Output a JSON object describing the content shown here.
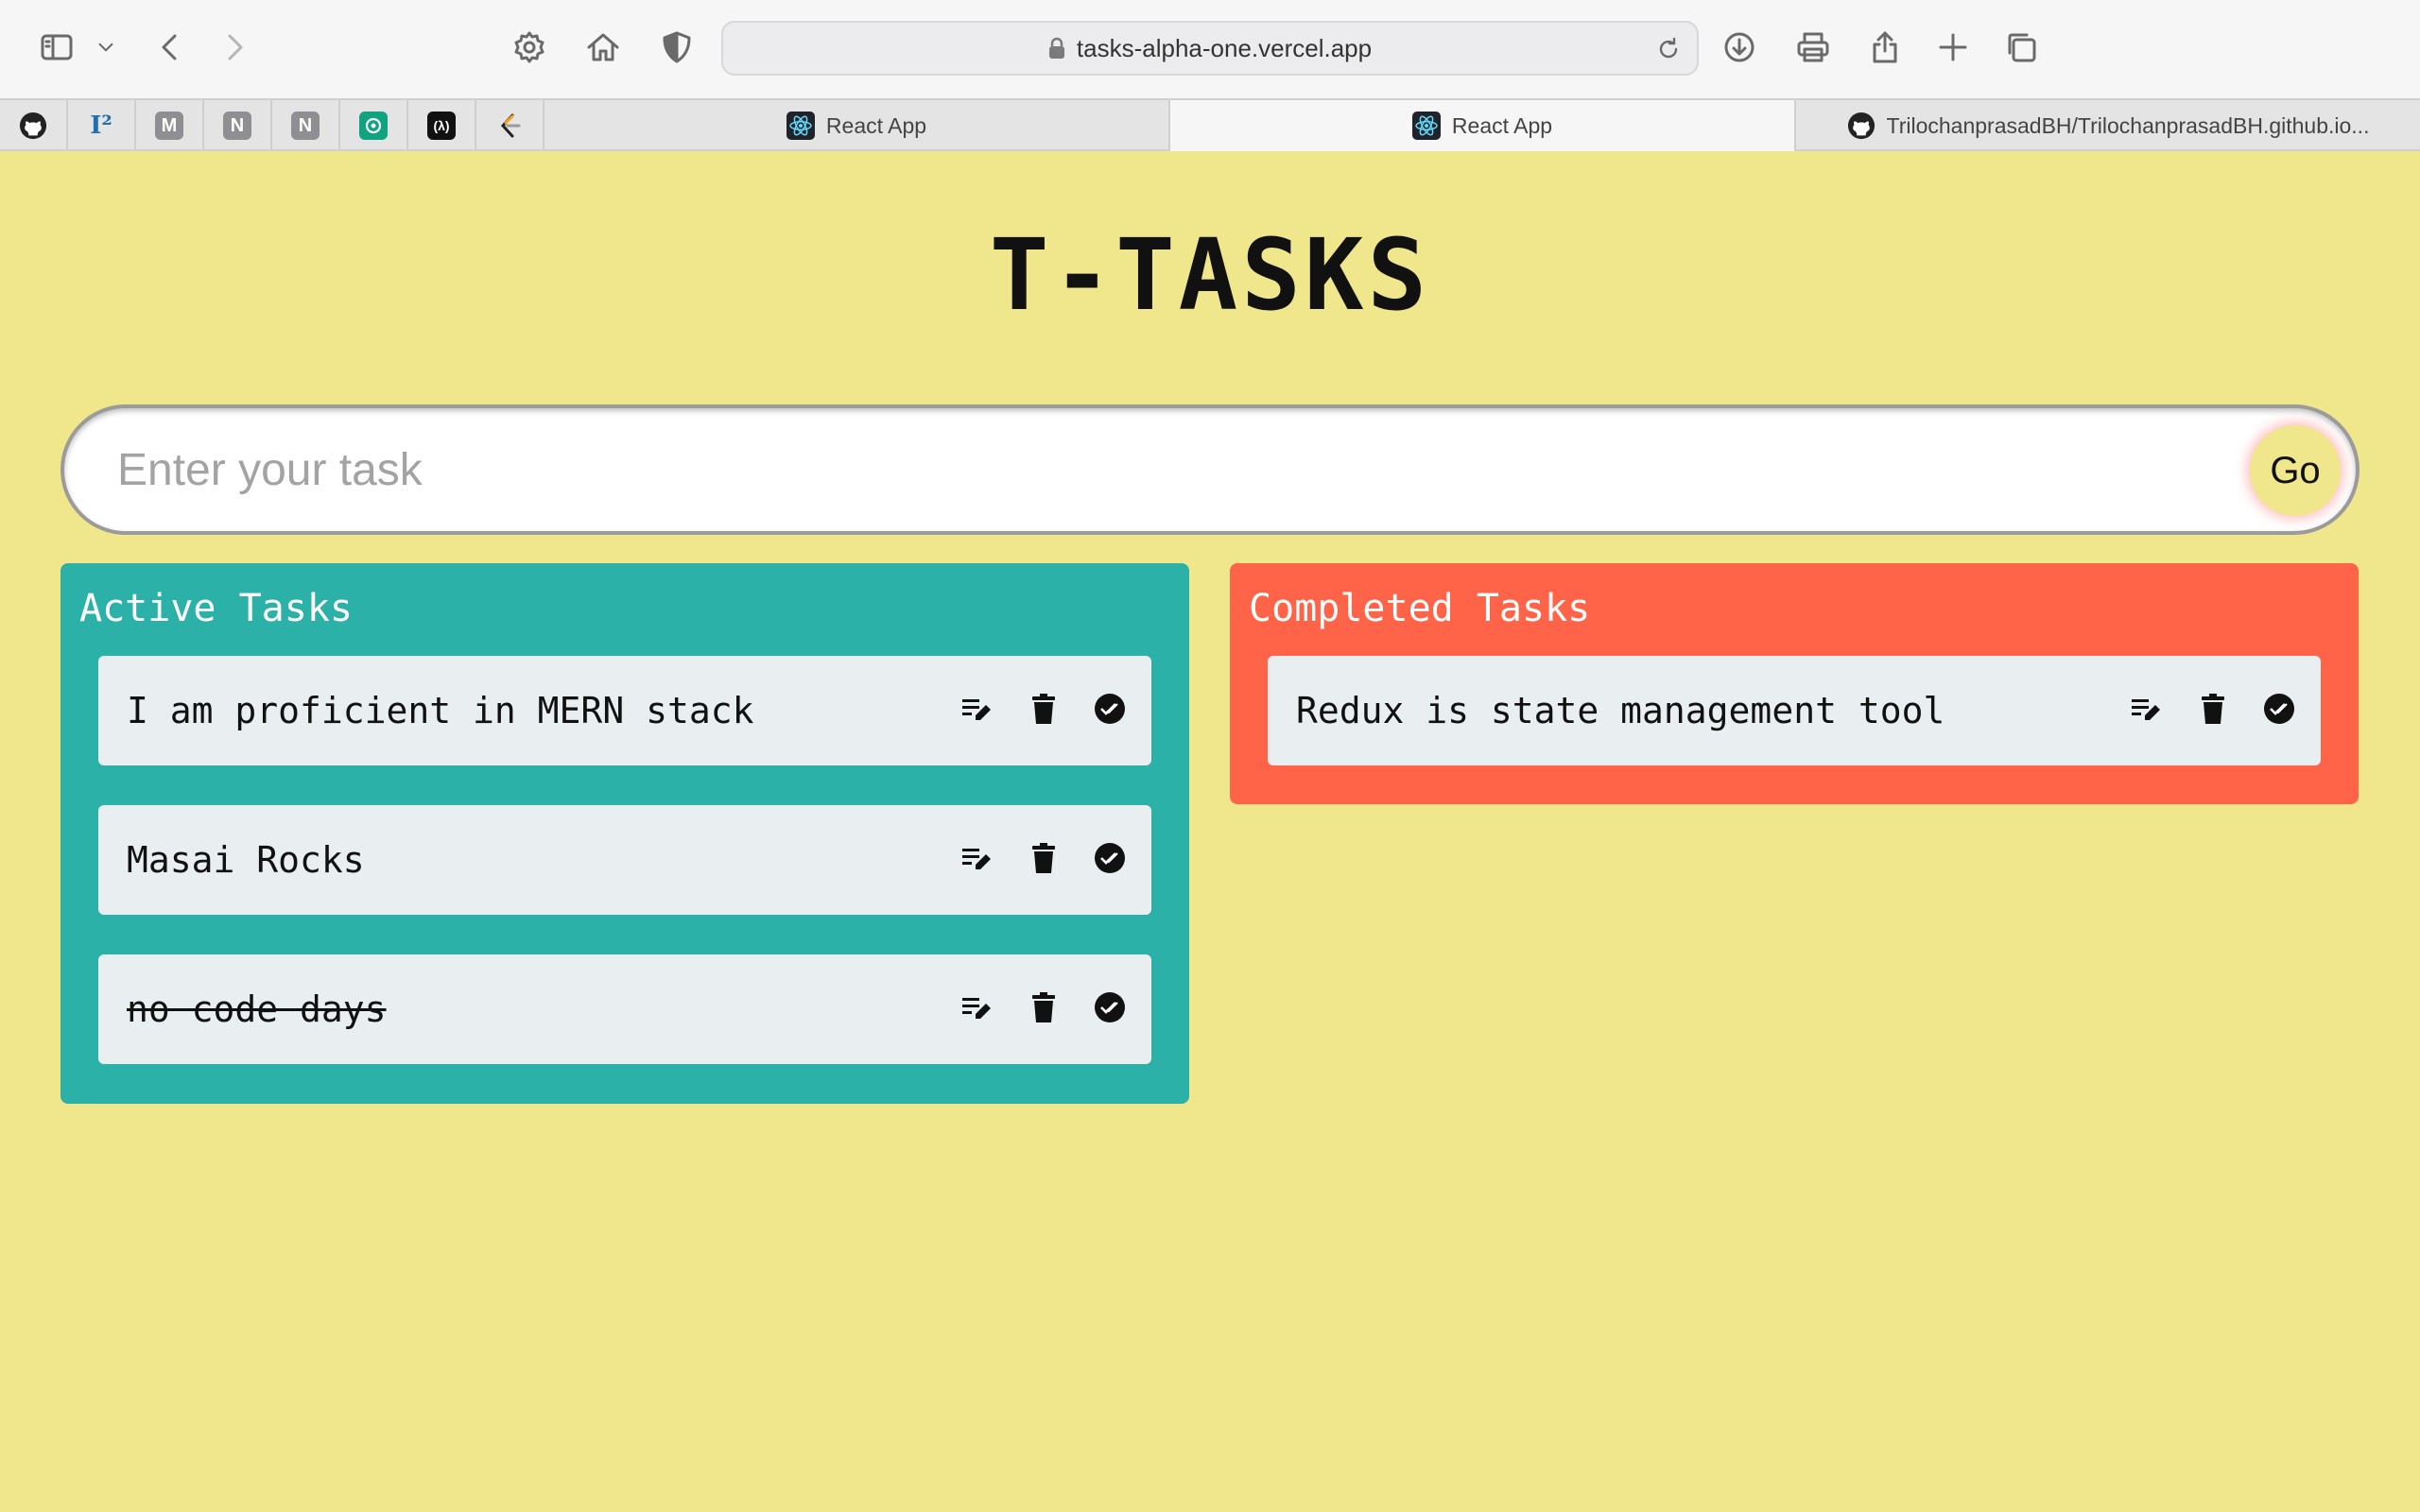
{
  "browser": {
    "url": "tasks-alpha-one.vercel.app",
    "pinned_tabs": [
      {
        "name": "github",
        "glyph": "",
        "color": "#222222"
      },
      {
        "name": "i2",
        "glyph": "I²",
        "color": "#1f6fb2"
      },
      {
        "name": "m",
        "glyph": "M",
        "color": "#8e8e93"
      },
      {
        "name": "n1",
        "glyph": "N",
        "color": "#8e8e93"
      },
      {
        "name": "n2",
        "glyph": "N",
        "color": "#8e8e93"
      },
      {
        "name": "chatgpt",
        "glyph": "",
        "color": "#10a37f"
      },
      {
        "name": "codepen",
        "glyph": "(λ)",
        "color": "#111111"
      },
      {
        "name": "leetcode",
        "glyph": "",
        "color": "#f89f1b"
      }
    ],
    "tabs": [
      {
        "label": "React App",
        "active": false
      },
      {
        "label": "React App",
        "active": true
      },
      {
        "label": "TrilochanprasadBH/TrilochanprasadBH.github.io...",
        "active": false
      }
    ]
  },
  "app": {
    "title": "T-TASKS",
    "input": {
      "placeholder": "Enter your task",
      "value": ""
    },
    "go_label": "Go",
    "active_heading": "Active Tasks",
    "completed_heading": "Completed Tasks",
    "active_tasks": [
      {
        "text": "I am proficient in MERN stack",
        "struck": false
      },
      {
        "text": "Masai Rocks",
        "struck": false
      },
      {
        "text": "no code days",
        "struck": true
      }
    ],
    "completed_tasks": [
      {
        "text": "Redux is state management tool",
        "struck": false
      }
    ]
  },
  "colors": {
    "page_bg": "#f0e68c",
    "active_panel": "#2cb1a9",
    "completed_panel": "#ff6348",
    "card_bg": "#e9eef1"
  }
}
